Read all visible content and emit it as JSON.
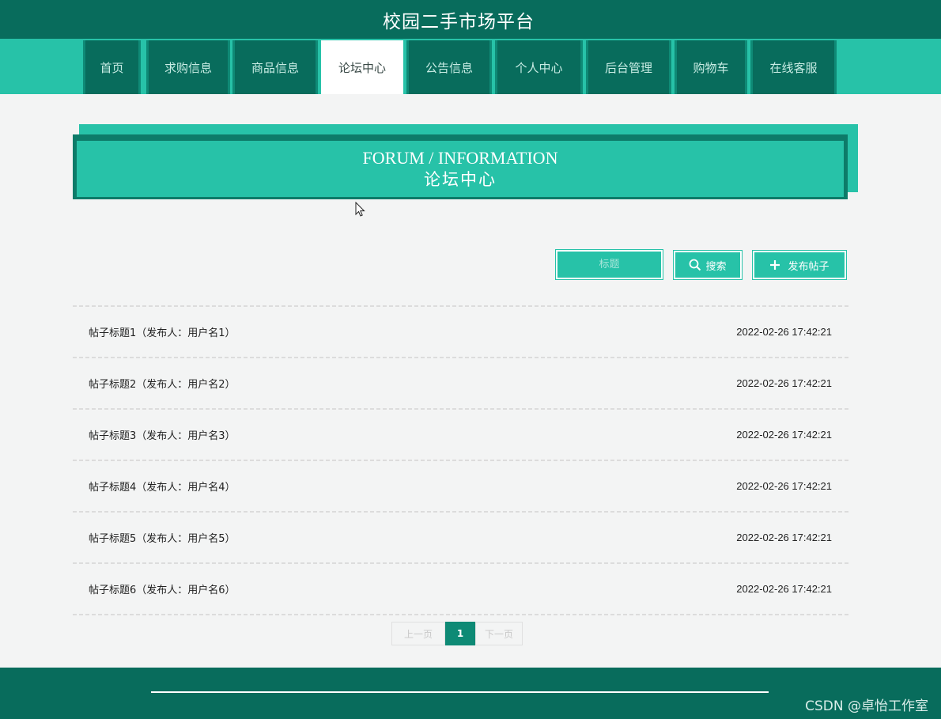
{
  "header": {
    "title": "校园二手市场平台"
  },
  "nav": {
    "items": [
      {
        "label": "首页"
      },
      {
        "label": "求购信息"
      },
      {
        "label": "商品信息"
      },
      {
        "label": "论坛中心"
      },
      {
        "label": "公告信息"
      },
      {
        "label": "个人中心"
      },
      {
        "label": "后台管理"
      },
      {
        "label": "购物车"
      },
      {
        "label": "在线客服"
      }
    ],
    "active_index": 3
  },
  "banner": {
    "title_en": "FORUM / INFORMATION",
    "title_cn": "论坛中心"
  },
  "search": {
    "placeholder": "标题",
    "search_label": "搜索",
    "publish_label": "发布帖子"
  },
  "posts": [
    {
      "title": "帖子标题1（发布人：用户名1）",
      "time": "2022-02-26 17:42:21"
    },
    {
      "title": "帖子标题2（发布人：用户名2）",
      "time": "2022-02-26 17:42:21"
    },
    {
      "title": "帖子标题3（发布人：用户名3）",
      "time": "2022-02-26 17:42:21"
    },
    {
      "title": "帖子标题4（发布人：用户名4）",
      "time": "2022-02-26 17:42:21"
    },
    {
      "title": "帖子标题5（发布人：用户名5）",
      "time": "2022-02-26 17:42:21"
    },
    {
      "title": "帖子标题6（发布人：用户名6）",
      "time": "2022-02-26 17:42:21"
    }
  ],
  "pagination": {
    "prev": "上一页",
    "current": "1",
    "next": "下一页"
  },
  "footer": {
    "watermark": "CSDN @卓怡工作室"
  },
  "colors": {
    "dark_green": "#086c5c",
    "accent": "#27c2a8",
    "page_bg": "#f3f4f4"
  }
}
